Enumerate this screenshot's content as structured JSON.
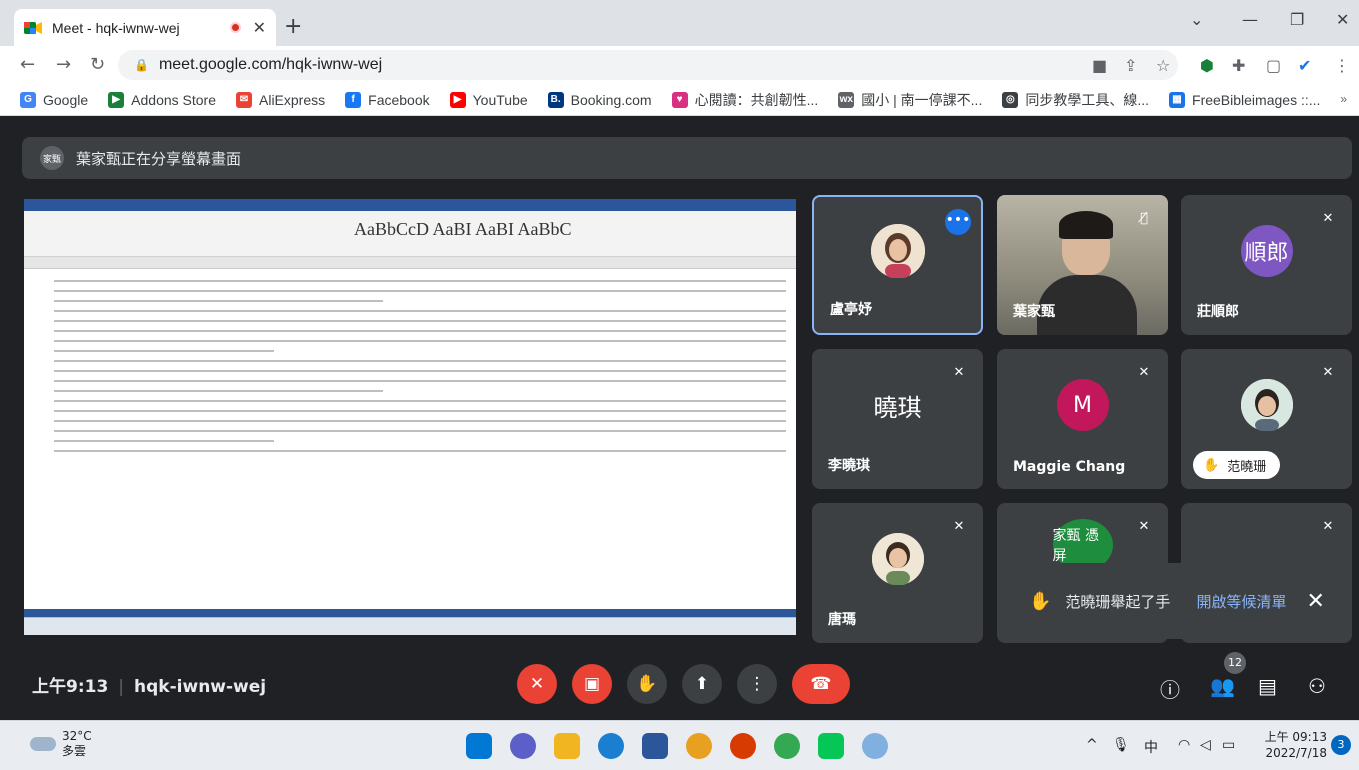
{
  "browser": {
    "tab_title": "Meet - hqk-iwnw-wej",
    "url": "meet.google.com/hqk-iwnw-wej",
    "bookmarks": [
      {
        "label": "Google",
        "color": "#4285f4",
        "glyph": "G"
      },
      {
        "label": "Addons Store",
        "color": "#188038",
        "glyph": "▶"
      },
      {
        "label": "AliExpress",
        "color": "#ea4335",
        "glyph": "✉"
      },
      {
        "label": "Facebook",
        "color": "#1877f2",
        "glyph": "f"
      },
      {
        "label": "YouTube",
        "color": "#ff0000",
        "glyph": "▶"
      },
      {
        "label": "Booking.com",
        "color": "#003580",
        "glyph": "B."
      },
      {
        "label": "心閱讀：共創韌性...",
        "color": "#d93082",
        "glyph": "♥"
      },
      {
        "label": "國小 | 南一停課不...",
        "color": "#5f6368",
        "glyph": "wx"
      },
      {
        "label": "同步教學工具、線...",
        "color": "#3c4043",
        "glyph": "◎"
      },
      {
        "label": "FreeBibleimages ::...",
        "color": "#1a73e8",
        "glyph": "▦"
      }
    ],
    "more": "»"
  },
  "meet": {
    "presenter_initials": "家甄",
    "share_banner": "葉家甄正在分享螢幕畫面",
    "tiles": [
      {
        "name": "盧亭妤",
        "type": "photo",
        "avatar_color": "#8b5a3c"
      },
      {
        "name": "葉家甄",
        "type": "video"
      },
      {
        "name": "莊順郎",
        "type": "initials",
        "initials": "順郎",
        "avatar_color": "#7e57c2"
      },
      {
        "name": "李曉琪",
        "type": "initials",
        "initials": "曉琪",
        "avatar_color": "#3c4043"
      },
      {
        "name": "Maggie Chang",
        "type": "initials",
        "initials": "M",
        "avatar_color": "#c2185b"
      },
      {
        "name": "范曉珊",
        "type": "photo",
        "avatar_color": "#a07850"
      },
      {
        "name": "唐瑪",
        "type": "photo",
        "avatar_color": "#8a6a4a"
      },
      {
        "name": "家甄 憑屏",
        "type": "initials",
        "initials": "家甄 憑屏",
        "avatar_color": "#1e8e3e"
      }
    ],
    "notification": {
      "text": "范曉珊舉起了手",
      "link": "開啟等候清單"
    },
    "time": "上午9:13",
    "meeting_code": "hqk-iwnw-wej",
    "participant_count": "12"
  },
  "taskbar": {
    "temperature": "32°C",
    "weather": "多雲",
    "ime": "中",
    "time": "上午 09:13",
    "date": "2022/7/18",
    "notifications": "3"
  }
}
